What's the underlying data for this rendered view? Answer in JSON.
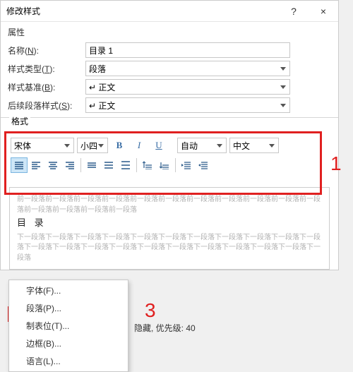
{
  "titlebar": {
    "title": "修改样式",
    "help": "?",
    "close": "×"
  },
  "section_props": "属性",
  "form": {
    "name_label": "名称(",
    "name_key": "N",
    "name_paren": "):",
    "name_value": "目录 1",
    "type_label": "样式类型(",
    "type_key": "T",
    "type_paren": "):",
    "type_value": "段落",
    "base_label": "样式基准(",
    "base_key": "B",
    "base_paren": "):",
    "base_value": "↵ 正文",
    "next_label": "后续段落样式(",
    "next_key": "S",
    "next_paren": "):",
    "next_value": "↵ 正文"
  },
  "section_format": "格式",
  "format": {
    "font": "宋体",
    "size": "小四",
    "color_label": "自动",
    "lang": "中文"
  },
  "callouts": {
    "c1": "1",
    "c3": "3"
  },
  "preview": {
    "before": "前一段落前一段落前一段落前一段落前一段落前一段落前一段落前一段落前一段落前一段落前一段落前一段落前一段落前一段落前一段落",
    "heading": "目 录",
    "after": "下一段落下一段落下一段落下一段落下一段落下一段落下一段落下一段落下一段落下一段落下一段落下一段落下一段落下一段落下一段落下一段落下一段落下一段落下一段落下一段落下一段落下一段落"
  },
  "menu": {
    "font": "字体(F)...",
    "para": "段落(P)...",
    "tabs": "制表位(T)...",
    "border": "边框(B)...",
    "lang": "语言(L)..."
  },
  "desc": "隐藏, 优先级: 40"
}
